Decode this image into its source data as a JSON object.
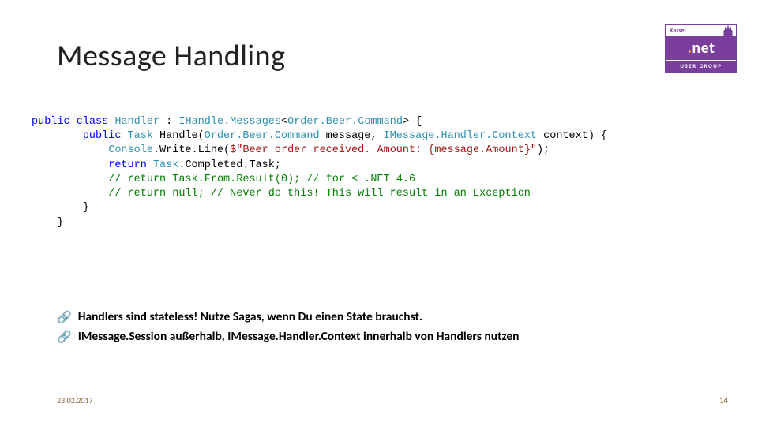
{
  "title": "Message Handling",
  "logo": {
    "top": "Kassel",
    "mid_dot": ".",
    "mid_text": "net",
    "bottom": "USER GROUP"
  },
  "code": {
    "l1_public": "public",
    "l1_class": "class",
    "l1_handler": "Handler",
    "l1_colon": " : ",
    "l1_iface": "IHandle.Messages",
    "l1_lt": "<",
    "l1_cmd": "Order.Beer.Command",
    "l1_gt": "> {",
    "l2_public": "public",
    "l2_task": "Task",
    "l2_handle": " Handle(",
    "l2_cmd": "Order.Beer.Command",
    "l2_msg": " message, ",
    "l2_ctx": "IMessage.Handler.Context",
    "l2_ctxend": " context) {",
    "l3_console": "Console",
    "l3_write": ".Write.Line(",
    "l3_str": "$\"Beer order received. Amount: {message.Amount}\"",
    "l3_end": ");",
    "l4_return": "return",
    "l4_task": "Task",
    "l4_rest": ".Completed.Task;",
    "l5": "// return Task.From.Result(0); // for < .NET 4.6",
    "l6": "// return null; // Never do this! This will result in an Exception",
    "l7": "}",
    "l8": "}"
  },
  "bullets": [
    {
      "prefix": "Handlers",
      "rest": " sind stateless! Nutze Sagas, wenn Du einen State brauchst."
    },
    {
      "prefix": "IMessage.Session",
      "rest_a": " außerhalb, ",
      "mid": "IMessage.Handler.Context",
      "rest_b": " innerhalb von Handlers nutzen"
    }
  ],
  "footer": {
    "date": "23.02.2017",
    "page": "14"
  }
}
